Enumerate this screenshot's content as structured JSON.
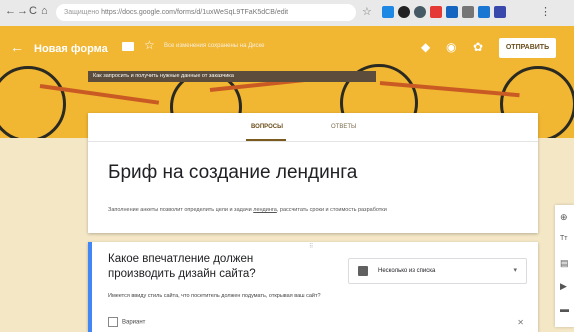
{
  "browser": {
    "nav_icons": [
      "←",
      "→",
      "C",
      "⌂"
    ],
    "site_label": "Защищено",
    "url": "https://docs.google.com/forms/d/1uxWeSqL9TFaK5dCB/edit",
    "extension_colors": [
      "#1e88e5",
      "#222222",
      "#455a64",
      "#e53935",
      "#1565c0",
      "#757575",
      "#1976d2",
      "#3949ab"
    ]
  },
  "header": {
    "form_name": "Новая форма",
    "subtitle": "Все изменения сохранены на Диске",
    "banner": "Как запросить и получить нужные данные от заказчика",
    "send_label": "ОТПРАВИТЬ",
    "icons": [
      "palette-icon",
      "eye-icon",
      "gear-icon"
    ]
  },
  "tabs": {
    "questions": "ВОПРОСЫ",
    "answers": "ОТВЕТЫ"
  },
  "form": {
    "title": "Бриф на создание лендинга",
    "description_before": "Заполнение анкеты позволит определить цели и задачи ",
    "description_link": "лендинга",
    "description_after": ", рассчитать сроки и стоимость разработки"
  },
  "question": {
    "text": "Какое впечатление должен производить дизайн сайта?",
    "type_label": "Несколько из списка",
    "hint": "Имеется ввиду стиль сайта, что посетитель должен подумать, открывая ваш сайт?",
    "option_label": "Вариант"
  },
  "side_toolbar": [
    "⊕",
    "Tт",
    "▤",
    "▶",
    "▬"
  ]
}
